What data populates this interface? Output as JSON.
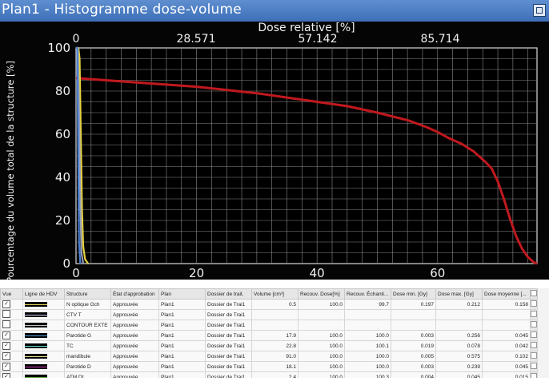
{
  "window": {
    "title": "Plan1 - Histogramme dose-volume"
  },
  "chart_data": {
    "type": "line",
    "title": "",
    "x_top_label": "Dose relative [%]",
    "top_ticks": [
      "0",
      "28.571",
      "57.142",
      "85.714"
    ],
    "xlabel": "",
    "ylabel": "Pourcentage du volume total de la structure [%]",
    "x_ticks": [
      0,
      20,
      40,
      60
    ],
    "y_ticks": [
      0,
      20,
      40,
      60,
      80,
      100
    ],
    "xlim": [
      0,
      76.5
    ],
    "ylim": [
      0,
      100
    ],
    "grid": true,
    "series": [
      {
        "color": "#c0191e",
        "x": [
          0,
          5,
          10,
          15,
          20,
          25,
          30,
          35,
          40,
          45,
          50,
          55,
          58,
          60,
          62,
          64,
          66,
          68,
          69,
          70,
          71,
          72,
          73,
          74,
          75,
          76,
          76.5
        ],
        "y": [
          86,
          85,
          84,
          83,
          82,
          80.5,
          79,
          77,
          75,
          73,
          70,
          66.5,
          63.5,
          61,
          58,
          55.5,
          52,
          47,
          44,
          38,
          30,
          21,
          13,
          7,
          3,
          0.5,
          0
        ]
      },
      {
        "color": "#e6d23c",
        "x": [
          0,
          0.4,
          0.6,
          0.8,
          1.0,
          1.2,
          1.5,
          2.0
        ],
        "y": [
          100,
          100,
          95,
          60,
          25,
          8,
          2,
          0
        ]
      },
      {
        "color": "#9aa0b8",
        "x": [
          0,
          0.3,
          0.5,
          0.7,
          0.9,
          1.2
        ],
        "y": [
          100,
          100,
          70,
          30,
          5,
          0
        ]
      },
      {
        "color": "#4a7fd0",
        "x": [
          0,
          0.2,
          0.3,
          0.5,
          0.7
        ],
        "y": [
          100,
          100,
          70,
          10,
          0
        ]
      }
    ]
  },
  "table": {
    "headers": [
      "Vue",
      "Ligne de HDV",
      "Structure",
      "État d'approbation",
      "Plan",
      "Dossier de trait.",
      "Volume [cm³]",
      "Recouv. Dose[%]",
      "Recouv. Échanti...",
      "Dose min. [Gy]",
      "Dose max. [Gy]",
      "Dose moyenne [..."
    ],
    "rows": [
      {
        "checked": true,
        "line_color": "#f0e060",
        "cells": [
          "N optique Gch",
          "Approuvée",
          "Plan1",
          "Dossier de Trai1",
          "0.5",
          "100.0",
          "99.7",
          "0.197",
          "0.212",
          "0.158"
        ]
      },
      {
        "checked": false,
        "line_color": "#d7c8f0",
        "cells": [
          "CTV T",
          "Approuvée",
          "Plan1",
          "Dossier de Trai1",
          "",
          "",
          "",
          "",
          "",
          ""
        ]
      },
      {
        "checked": false,
        "line_color": "#c0c0c0",
        "cells": [
          "CONTOUR EXTE",
          "Approuvée",
          "Plan1",
          "Dossier de Trai1",
          "",
          "",
          "",
          "",
          "",
          ""
        ]
      },
      {
        "checked": true,
        "line_color": "#4a9fe0",
        "cells": [
          "Parotide G",
          "Approuvée",
          "Plan1",
          "Dossier de Trai1",
          "17.9",
          "100.0",
          "100.0",
          "0.003",
          "0.256",
          "0.045"
        ]
      },
      {
        "checked": true,
        "line_color": "#66e0d0",
        "cells": [
          "TC",
          "Approuvée",
          "Plan1",
          "Dossier de Trai1",
          "22.8",
          "100.0",
          "100.1",
          "0.019",
          "0.078",
          "0.042"
        ]
      },
      {
        "checked": true,
        "line_color": "#e0e090",
        "cells": [
          "mandibule",
          "Approuvée",
          "Plan1",
          "Dossier de Trai1",
          "91.0",
          "100.0",
          "100.0",
          "0.005",
          "0.575",
          "0.102"
        ]
      },
      {
        "checked": true,
        "line_color": "#d040c0",
        "cells": [
          "Parotide D",
          "Approuvée",
          "Plan1",
          "Dossier de Trai1",
          "18.1",
          "100.0",
          "100.0",
          "0.003",
          "0.239",
          "0.045"
        ]
      },
      {
        "checked": true,
        "line_color": "#5a9a3a",
        "cells": [
          "ATM Dt",
          "Approuvée",
          "Plan1",
          "Dossier de Trai1",
          "2.4",
          "100.0",
          "100.3",
          "0.004",
          "0.045",
          "0.015"
        ]
      }
    ]
  }
}
